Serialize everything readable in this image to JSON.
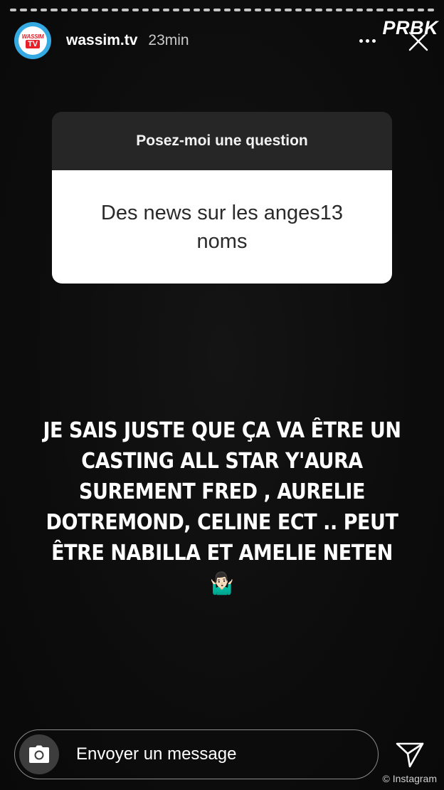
{
  "progress": {
    "segments": 42
  },
  "header": {
    "username": "wassim.tv",
    "time": "23min",
    "avatar_logo_top": "WASSIM",
    "avatar_logo_bottom": "TV"
  },
  "watermark": "PRBK",
  "question_card": {
    "title": "Posez-moi une question",
    "question": "Des news sur les anges13 noms"
  },
  "answer": {
    "text": "JE SAIS JUSTE QUE ÇA VA ÊTRE UN CASTING ALL STAR Y'AURA SUREMENT FRED , AURELIE DOTREMOND, CELINE ECT .. PEUT ÊTRE NABILLA ET AMELIE NETEN",
    "emoji": "🤷🏻‍♂️"
  },
  "footer": {
    "message_placeholder": "Envoyer un message",
    "credit": "© Instagram"
  },
  "colors": {
    "background": "#0b0b0b",
    "card_header": "#262626",
    "card_body": "#ffffff",
    "avatar_ring": "#35a9e1",
    "logo_red": "#e8202a"
  },
  "icons": [
    "more-icon",
    "close-icon",
    "camera-icon",
    "send-icon"
  ]
}
